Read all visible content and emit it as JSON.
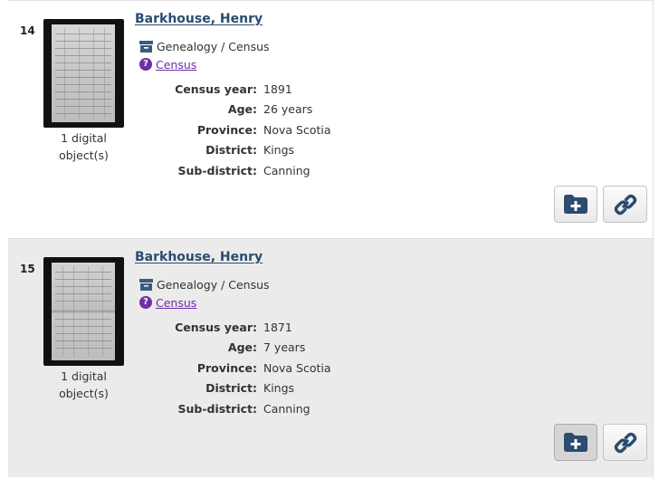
{
  "colors": {
    "title": "#2b4b6f",
    "category": "#6f2da8",
    "icon": "#3a5a80",
    "alt_row": "#ebebeb"
  },
  "records": [
    {
      "number": "14",
      "title": "Barkhouse, Henry",
      "digital_objects": "1 digital object(s)",
      "type": "Genealogy / Census",
      "category": "Census",
      "fields": [
        {
          "label": "Census year:",
          "value": "1891"
        },
        {
          "label": "Age:",
          "value": "26 years"
        },
        {
          "label": "Province:",
          "value": "Nova Scotia"
        },
        {
          "label": "District:",
          "value": "Kings"
        },
        {
          "label": "Sub-district:",
          "value": "Canning"
        }
      ],
      "icons": {
        "type": "archive-box-icon",
        "category": "question-circle-icon",
        "add": "folder-plus-icon",
        "link": "link-icon"
      }
    },
    {
      "number": "15",
      "title": "Barkhouse, Henry",
      "digital_objects": "1 digital object(s)",
      "type": "Genealogy / Census",
      "category": "Census",
      "fields": [
        {
          "label": "Census year:",
          "value": "1871"
        },
        {
          "label": "Age:",
          "value": "7 years"
        },
        {
          "label": "Province:",
          "value": "Nova Scotia"
        },
        {
          "label": "District:",
          "value": "Kings"
        },
        {
          "label": "Sub-district:",
          "value": "Canning"
        }
      ],
      "icons": {
        "type": "archive-box-icon",
        "category": "question-circle-icon",
        "add": "folder-plus-icon",
        "link": "link-icon"
      }
    }
  ]
}
